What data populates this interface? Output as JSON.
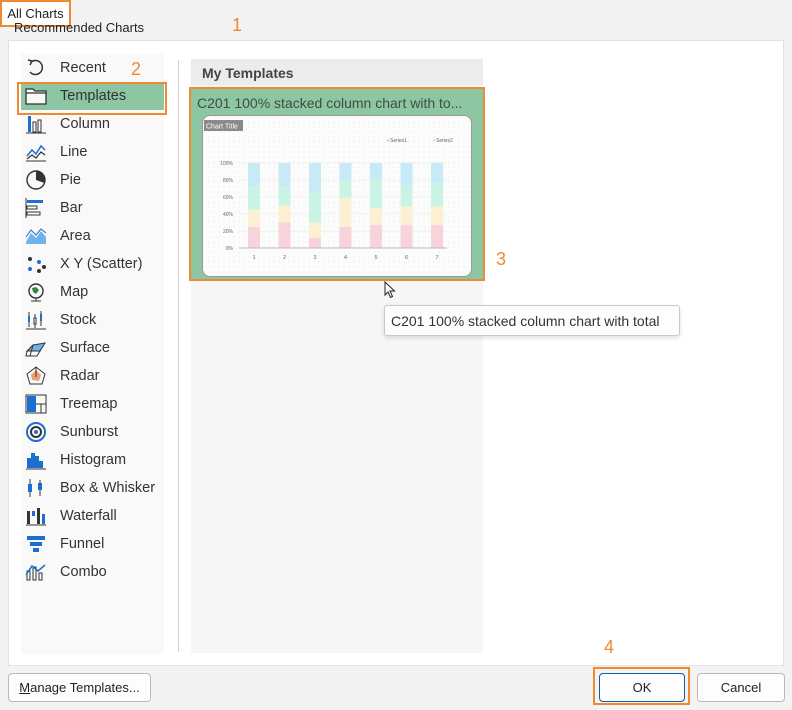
{
  "tabs": {
    "recommended": "Recommended Charts",
    "all": "All Charts"
  },
  "annotations": {
    "one": "1",
    "two": "2",
    "three": "3",
    "four": "4"
  },
  "categories": [
    {
      "label": "Recent",
      "icon": "recent-icon"
    },
    {
      "label": "Templates",
      "icon": "folder-icon"
    },
    {
      "label": "Column",
      "icon": "column-chart-icon"
    },
    {
      "label": "Line",
      "icon": "line-chart-icon"
    },
    {
      "label": "Pie",
      "icon": "pie-chart-icon"
    },
    {
      "label": "Bar",
      "icon": "bar-chart-icon"
    },
    {
      "label": "Area",
      "icon": "area-chart-icon"
    },
    {
      "label": "X Y (Scatter)",
      "icon": "scatter-chart-icon"
    },
    {
      "label": "Map",
      "icon": "map-chart-icon"
    },
    {
      "label": "Stock",
      "icon": "stock-chart-icon"
    },
    {
      "label": "Surface",
      "icon": "surface-chart-icon"
    },
    {
      "label": "Radar",
      "icon": "radar-chart-icon"
    },
    {
      "label": "Treemap",
      "icon": "treemap-chart-icon"
    },
    {
      "label": "Sunburst",
      "icon": "sunburst-chart-icon"
    },
    {
      "label": "Histogram",
      "icon": "histogram-chart-icon"
    },
    {
      "label": "Box & Whisker",
      "icon": "box-whisker-chart-icon"
    },
    {
      "label": "Waterfall",
      "icon": "waterfall-chart-icon"
    },
    {
      "label": "Funnel",
      "icon": "funnel-chart-icon"
    },
    {
      "label": "Combo",
      "icon": "combo-chart-icon"
    }
  ],
  "templates": {
    "header": "My Templates",
    "card_title": "C201 100% stacked column chart with to...",
    "tooltip": "C201 100% stacked column chart with total"
  },
  "preview": {
    "title": "Chart Title",
    "legend": [
      "Series1",
      "Series2"
    ],
    "y_ticks": [
      "100%",
      "80%",
      "60%",
      "40%",
      "20%",
      "0%"
    ],
    "x_ticks": [
      "1",
      "2",
      "3",
      "4",
      "5",
      "6",
      "7"
    ],
    "colors": [
      "#f9d3dc",
      "#fcefd2",
      "#c9f3e4",
      "#c8eaf6"
    ]
  },
  "buttons": {
    "manage": "Manage Templates...",
    "ok": "OK",
    "cancel": "Cancel"
  },
  "accent": "#f08a32",
  "selected_bg": "#8dc6a2"
}
